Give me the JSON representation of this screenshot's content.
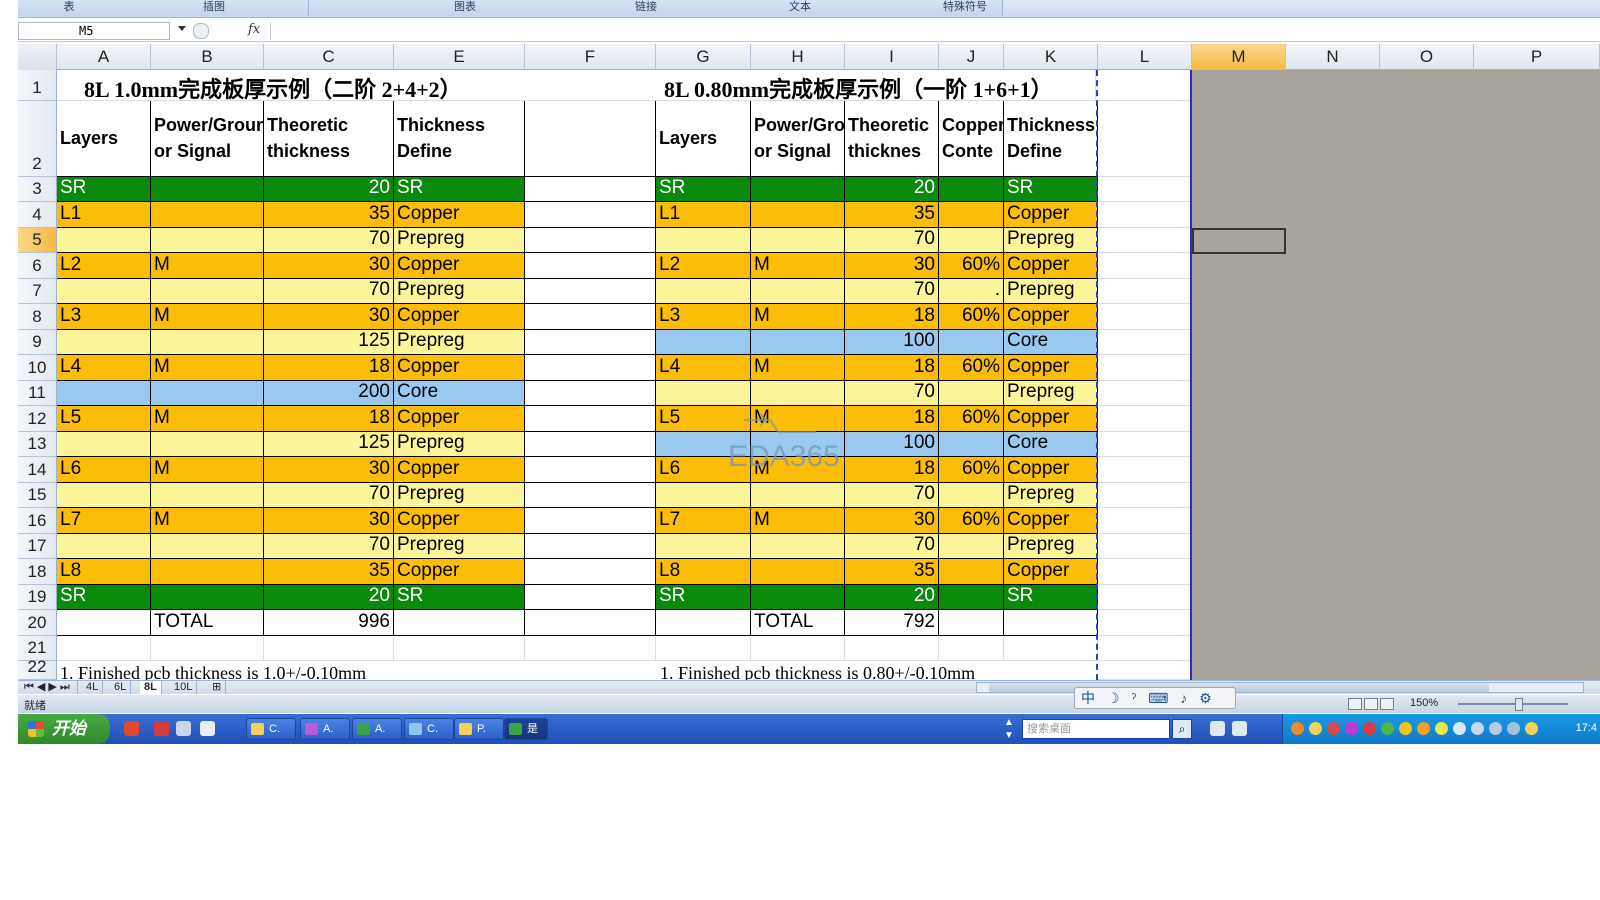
{
  "ribbon": {
    "groups": [
      "表",
      "插图",
      "图表",
      "链接",
      "文本",
      "特殊符号"
    ]
  },
  "formula_bar": {
    "name_box": "M5",
    "fx": "fx",
    "formula": ""
  },
  "columns": [
    "A",
    "B",
    "C",
    "E",
    "F",
    "G",
    "H",
    "I",
    "J",
    "K",
    "L",
    "M",
    "N",
    "O",
    "P"
  ],
  "rows": [
    "1",
    "2",
    "3",
    "4",
    "5",
    "6",
    "7",
    "8",
    "9",
    "10",
    "11",
    "12",
    "13",
    "14",
    "15",
    "16",
    "17",
    "18",
    "19",
    "20",
    "21",
    "22"
  ],
  "left_table": {
    "title": "8L 1.0mm完成板厚示例（二阶 2+4+2）",
    "headers": [
      "Layers",
      "Power/Ground or Signal",
      "Theoretic thickness",
      "Thickness Define"
    ],
    "rows": [
      {
        "layer": "SR",
        "ps": "",
        "thick": "20",
        "define": "SR",
        "kind": "sr"
      },
      {
        "layer": "L1",
        "ps": "",
        "thick": "35",
        "define": "Copper",
        "kind": "copper"
      },
      {
        "layer": "",
        "ps": "",
        "thick": "70",
        "define": "Prepreg",
        "kind": "prepreg"
      },
      {
        "layer": "L2",
        "ps": "M",
        "thick": "30",
        "define": "Copper",
        "kind": "copper"
      },
      {
        "layer": "",
        "ps": "",
        "thick": "70",
        "define": "Prepreg",
        "kind": "prepreg"
      },
      {
        "layer": "L3",
        "ps": "M",
        "thick": "30",
        "define": "Copper",
        "kind": "copper"
      },
      {
        "layer": "",
        "ps": "",
        "thick": "125",
        "define": "Prepreg",
        "kind": "prepreg"
      },
      {
        "layer": "L4",
        "ps": "M",
        "thick": "18",
        "define": "Copper",
        "kind": "copper"
      },
      {
        "layer": "",
        "ps": "",
        "thick": "200",
        "define": "Core",
        "kind": "core"
      },
      {
        "layer": "L5",
        "ps": "M",
        "thick": "18",
        "define": "Copper",
        "kind": "copper"
      },
      {
        "layer": "",
        "ps": "",
        "thick": "125",
        "define": "Prepreg",
        "kind": "prepreg"
      },
      {
        "layer": "L6",
        "ps": "M",
        "thick": "30",
        "define": "Copper",
        "kind": "copper"
      },
      {
        "layer": "",
        "ps": "",
        "thick": "70",
        "define": "Prepreg",
        "kind": "prepreg"
      },
      {
        "layer": "L7",
        "ps": "M",
        "thick": "30",
        "define": "Copper",
        "kind": "copper"
      },
      {
        "layer": "",
        "ps": "",
        "thick": "70",
        "define": "Prepreg",
        "kind": "prepreg"
      },
      {
        "layer": "L8",
        "ps": "",
        "thick": "35",
        "define": "Copper",
        "kind": "copper"
      },
      {
        "layer": "SR",
        "ps": "",
        "thick": "20",
        "define": "SR",
        "kind": "sr"
      }
    ],
    "total_label": "TOTAL",
    "total_value": "996",
    "note": "1.   Finished pcb thickness is 1.0+/-0.10mm"
  },
  "right_table": {
    "title": "8L 0.80mm完成板厚示例（一阶 1+6+1）",
    "headers": [
      "Layers",
      "Power/Ground or Signal",
      "Theoretic thicknes",
      "Copper Conte",
      "Thickness Define"
    ],
    "rows": [
      {
        "layer": "SR",
        "ps": "",
        "thick": "20",
        "cu": "",
        "define": "SR",
        "kind": "sr"
      },
      {
        "layer": "L1",
        "ps": "",
        "thick": "35",
        "cu": "",
        "define": "Copper",
        "kind": "copper"
      },
      {
        "layer": "",
        "ps": "",
        "thick": "70",
        "cu": "",
        "define": "Prepreg",
        "kind": "prepreg"
      },
      {
        "layer": "L2",
        "ps": "M",
        "thick": "30",
        "cu": "60%",
        "define": "Copper",
        "kind": "copper"
      },
      {
        "layer": "",
        "ps": "",
        "thick": "70",
        "cu": ".",
        "define": "Prepreg",
        "kind": "prepreg"
      },
      {
        "layer": "L3",
        "ps": "M",
        "thick": "18",
        "cu": "60%",
        "define": "Copper",
        "kind": "copper"
      },
      {
        "layer": "",
        "ps": "",
        "thick": "100",
        "cu": "",
        "define": "Core",
        "kind": "core"
      },
      {
        "layer": "L4",
        "ps": "M",
        "thick": "18",
        "cu": "60%",
        "define": "Copper",
        "kind": "copper"
      },
      {
        "layer": "",
        "ps": "",
        "thick": "70",
        "cu": "",
        "define": "Prepreg",
        "kind": "prepreg"
      },
      {
        "layer": "L5",
        "ps": "M",
        "thick": "18",
        "cu": "60%",
        "define": "Copper",
        "kind": "copper"
      },
      {
        "layer": "",
        "ps": "",
        "thick": "100",
        "cu": "",
        "define": "Core",
        "kind": "core"
      },
      {
        "layer": "L6",
        "ps": "M",
        "thick": "18",
        "cu": "60%",
        "define": "Copper",
        "kind": "copper"
      },
      {
        "layer": "",
        "ps": "",
        "thick": "70",
        "cu": "",
        "define": "Prepreg",
        "kind": "prepreg"
      },
      {
        "layer": "L7",
        "ps": "M",
        "thick": "30",
        "cu": "60%",
        "define": "Copper",
        "kind": "copper"
      },
      {
        "layer": "",
        "ps": "",
        "thick": "70",
        "cu": "",
        "define": "Prepreg",
        "kind": "prepreg"
      },
      {
        "layer": "L8",
        "ps": "",
        "thick": "35",
        "cu": "",
        "define": "Copper",
        "kind": "copper"
      },
      {
        "layer": "SR",
        "ps": "",
        "thick": "20",
        "cu": "",
        "define": "SR",
        "kind": "sr"
      }
    ],
    "total_label": "TOTAL",
    "total_value": "792",
    "note": "1.   Finished pcb thickness is 0.80+/-0.10mm"
  },
  "colors": {
    "sr": "#0a8a0a",
    "copper": "#fbbd08",
    "prepreg": "#fdf59a",
    "core": "#99c8f0",
    "selected_header": "#f4b945"
  },
  "watermark": "EDA365",
  "sheet_tabs": [
    "4L",
    "6L",
    "8L",
    "10L"
  ],
  "status": {
    "text": "就绪",
    "zoom": "150%",
    "ime": "中 ☽ ˀ ⌨ ♪ ⚙"
  },
  "taskbar": {
    "start": "开始",
    "buttons": [
      "C.",
      "A.",
      "A.",
      "C.",
      "P.",
      "是"
    ],
    "search_placeholder": "搜索桌面",
    "clock": "17:4"
  }
}
